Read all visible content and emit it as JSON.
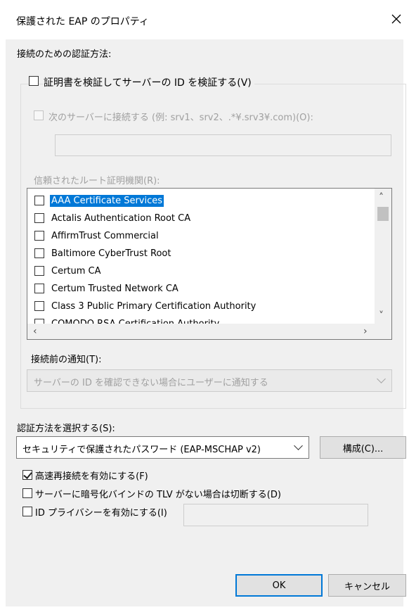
{
  "window": {
    "title": "保護された EAP のプロパティ",
    "close_glyph": "✕"
  },
  "connect_section": {
    "heading": "接続のための認証方法:",
    "verify_server_cert": {
      "label": "証明書を検証してサーバーの ID を検証する(V)",
      "checked": false
    },
    "connect_to_servers": {
      "label": "次のサーバーに接続する (例: srv1、srv2、.*¥.srv3¥.com)(O):",
      "checked": false,
      "enabled": false
    },
    "server_names_value": "",
    "trusted_root_label": "信頼されたルート証明機関(R):",
    "trusted_roots": [
      {
        "name": "AAA Certificate Services",
        "checked": false,
        "selected": true
      },
      {
        "name": "Actalis Authentication Root CA",
        "checked": false,
        "selected": false
      },
      {
        "name": "AffirmTrust Commercial",
        "checked": false,
        "selected": false
      },
      {
        "name": "Baltimore CyberTrust Root",
        "checked": false,
        "selected": false
      },
      {
        "name": "Certum CA",
        "checked": false,
        "selected": false
      },
      {
        "name": "Certum Trusted Network CA",
        "checked": false,
        "selected": false
      },
      {
        "name": "Class 3 Public Primary Certification Authority",
        "checked": false,
        "selected": false
      },
      {
        "name": "COMODO RSA Certification Authority",
        "checked": false,
        "selected": false
      }
    ],
    "notify_label": "接続前の通知(T):",
    "notify_value": "サーバーの ID を確認できない場合にユーザーに通知する"
  },
  "auth_method": {
    "label": "認証方法を選択する(S):",
    "value": "セキュリティで保護されたパスワード (EAP-MSCHAP v2)",
    "configure_label": "構成(C)..."
  },
  "options": {
    "fast_reconnect": {
      "label": "高速再接続を有効にする(F)",
      "checked": true
    },
    "disconnect_no_tlv": {
      "label": "サーバーに暗号化バインドの TLV がない場合は切断する(D)",
      "checked": false
    },
    "id_privacy": {
      "label": "ID プライバシーを有効にする(I)",
      "checked": false,
      "value": ""
    }
  },
  "buttons": {
    "ok": "OK",
    "cancel": "キャンセル"
  }
}
